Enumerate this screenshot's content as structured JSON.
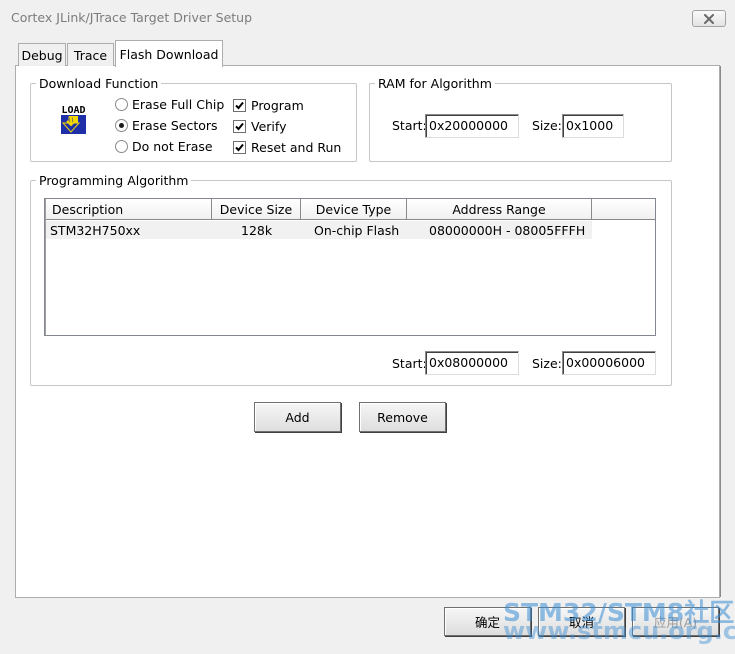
{
  "window": {
    "title": "Cortex JLink/JTrace Target Driver Setup"
  },
  "tabs": [
    {
      "label": "Debug",
      "active": false
    },
    {
      "label": "Trace",
      "active": false
    },
    {
      "label": "Flash Download",
      "active": true
    }
  ],
  "download_function": {
    "label": "Download Function",
    "icon": "load-icon",
    "icon_text": "LOAD",
    "erase_options": [
      {
        "label": "Erase Full Chip",
        "selected": false
      },
      {
        "label": "Erase Sectors",
        "selected": true
      },
      {
        "label": "Do not Erase",
        "selected": false
      }
    ],
    "checks": [
      {
        "label": "Program",
        "checked": true
      },
      {
        "label": "Verify",
        "checked": true
      },
      {
        "label": "Reset and Run",
        "checked": true
      }
    ]
  },
  "ram_for_algorithm": {
    "label": "RAM for Algorithm",
    "start_label": "Start:",
    "start_value": "0x20000000",
    "size_label": "Size:",
    "size_value": "0x1000"
  },
  "programming_algorithm": {
    "label": "Programming Algorithm",
    "columns": [
      "Description",
      "Device Size",
      "Device Type",
      "Address Range"
    ],
    "rows": [
      {
        "description": "STM32H750xx",
        "device_size": "128k",
        "device_type": "On-chip Flash",
        "address_range": "08000000H - 08005FFFH"
      }
    ],
    "start_label": "Start:",
    "start_value": "0x08000000",
    "size_label": "Size:",
    "size_value": "0x00006000"
  },
  "buttons": {
    "add": "Add",
    "remove": "Remove",
    "ok": "确定",
    "cancel": "取消",
    "apply": "应用(A)"
  },
  "watermark": {
    "line1": "STM32/STM8社区",
    "line2": "www.stmcu.org.cn"
  },
  "colors": {
    "accent": "#3a8cd2",
    "load_icon_blue": "#1f2fa8",
    "load_icon_yellow": "#f5d700"
  }
}
